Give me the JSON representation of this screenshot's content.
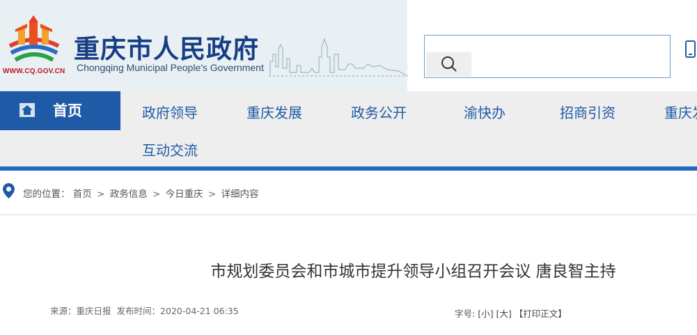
{
  "header": {
    "title": "重庆市人民政府",
    "subtitle": "Chongqing Municipal People's Government",
    "logo_url_text": "WWW.CQ.GOV.CN"
  },
  "search": {
    "placeholder": "",
    "button_icon": "search-icon"
  },
  "nav": {
    "home_label": "首页",
    "items": [
      "政府领导",
      "重庆发展",
      "政务公开",
      "渝快办",
      "招商引资",
      "重庆发",
      "互动交流"
    ]
  },
  "breadcrumb": {
    "prefix": "您的位置：",
    "items": [
      "首页",
      "政务信息",
      "今日重庆",
      "详细内容"
    ],
    "separator": ">"
  },
  "article": {
    "title": "市规划委员会和市城市提升领导小组召开会议 唐良智主持",
    "source_label": "来源：",
    "source": "重庆日报",
    "published_label": "发布时间：",
    "published": "2020-04-21 06:35",
    "fontsize_label": "字号:",
    "fontsize_small": "[小]",
    "fontsize_large": "[大]",
    "print_label": "【打印正文】"
  },
  "colors": {
    "brand_blue": "#1f5aa6",
    "title_blue": "#173e85",
    "nav_bg": "#eeeeee",
    "header_bg": "#e9f0f3"
  }
}
